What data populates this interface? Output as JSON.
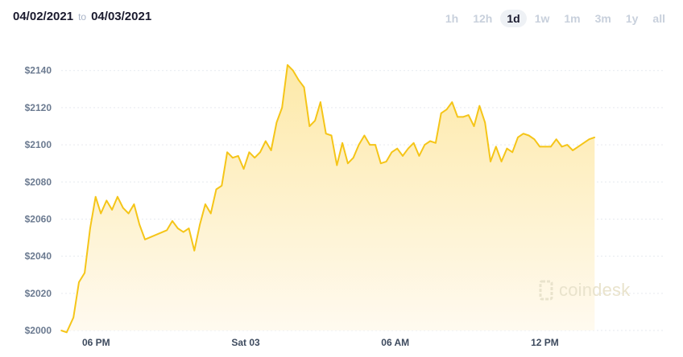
{
  "header": {
    "date_from": "04/02/2021",
    "to_label": "to",
    "date_to": "04/03/2021"
  },
  "range_tabs": [
    {
      "label": "1h",
      "active": false
    },
    {
      "label": "12h",
      "active": false
    },
    {
      "label": "1d",
      "active": true
    },
    {
      "label": "1w",
      "active": false
    },
    {
      "label": "1m",
      "active": false
    },
    {
      "label": "3m",
      "active": false
    },
    {
      "label": "1y",
      "active": false
    },
    {
      "label": "all",
      "active": false
    }
  ],
  "watermark": {
    "text": "coindesk"
  },
  "colors": {
    "line": "#f5c518",
    "fill_top": "#fde9a8",
    "fill_bottom": "#fffaf0",
    "active_tab_bg": "#eef1f5"
  },
  "chart_data": {
    "type": "area",
    "title": "",
    "xlabel": "",
    "ylabel": "",
    "ylim": [
      2000,
      2152
    ],
    "y_ticks": [
      2000,
      2020,
      2040,
      2060,
      2080,
      2100,
      2120,
      2140
    ],
    "y_tick_labels": [
      "$2000",
      "$2020",
      "$2040",
      "$2060",
      "$2080",
      "$2100",
      "$2120",
      "$2140"
    ],
    "x_unit": "hour",
    "x_range": [
      16.6,
      40.8
    ],
    "x_ticks": [
      18,
      24,
      30,
      36
    ],
    "x_tick_labels": [
      "06 PM",
      "Sat 03",
      "06 AM",
      "12 PM"
    ],
    "grid": "horizontal",
    "series": [
      {
        "values": [
          [
            16.6,
            2000
          ],
          [
            16.82,
            1999
          ],
          [
            17.09,
            2007
          ],
          [
            17.31,
            2026
          ],
          [
            17.54,
            2031
          ],
          [
            17.76,
            2055
          ],
          [
            17.98,
            2072
          ],
          [
            18.19,
            2063
          ],
          [
            18.42,
            2070
          ],
          [
            18.64,
            2065
          ],
          [
            18.86,
            2072
          ],
          [
            19.08,
            2066
          ],
          [
            19.3,
            2063
          ],
          [
            19.52,
            2068
          ],
          [
            19.74,
            2057
          ],
          [
            19.96,
            2049
          ],
          [
            20.84,
            2054
          ],
          [
            21.06,
            2059
          ],
          [
            21.28,
            2055
          ],
          [
            21.5,
            2053
          ],
          [
            21.72,
            2055
          ],
          [
            21.94,
            2043
          ],
          [
            22.16,
            2057
          ],
          [
            22.38,
            2068
          ],
          [
            22.6,
            2063
          ],
          [
            22.82,
            2076
          ],
          [
            23.04,
            2078
          ],
          [
            23.26,
            2096
          ],
          [
            23.48,
            2093
          ],
          [
            23.7,
            2094
          ],
          [
            23.92,
            2087
          ],
          [
            24.14,
            2096
          ],
          [
            24.36,
            2093
          ],
          [
            24.58,
            2096
          ],
          [
            24.8,
            2102
          ],
          [
            25.02,
            2097
          ],
          [
            25.24,
            2112
          ],
          [
            25.46,
            2120
          ],
          [
            25.68,
            2143
          ],
          [
            25.9,
            2140
          ],
          [
            26.12,
            2135
          ],
          [
            26.34,
            2131
          ],
          [
            26.56,
            2110
          ],
          [
            26.78,
            2113
          ],
          [
            27.0,
            2123
          ],
          [
            27.22,
            2106
          ],
          [
            27.44,
            2105
          ],
          [
            27.66,
            2089
          ],
          [
            27.88,
            2101
          ],
          [
            28.1,
            2090
          ],
          [
            28.32,
            2093
          ],
          [
            28.54,
            2100
          ],
          [
            28.76,
            2105
          ],
          [
            28.98,
            2100
          ],
          [
            29.2,
            2100
          ],
          [
            29.42,
            2090
          ],
          [
            29.64,
            2091
          ],
          [
            29.86,
            2096
          ],
          [
            30.08,
            2098
          ],
          [
            30.3,
            2094
          ],
          [
            30.52,
            2098
          ],
          [
            30.74,
            2101
          ],
          [
            30.96,
            2094
          ],
          [
            31.18,
            2100
          ],
          [
            31.4,
            2102
          ],
          [
            31.62,
            2101
          ],
          [
            31.84,
            2117
          ],
          [
            32.06,
            2119
          ],
          [
            32.28,
            2123
          ],
          [
            32.5,
            2115
          ],
          [
            32.72,
            2115
          ],
          [
            32.94,
            2116
          ],
          [
            33.16,
            2110
          ],
          [
            33.38,
            2121
          ],
          [
            33.6,
            2112
          ],
          [
            33.82,
            2091
          ],
          [
            34.04,
            2099
          ],
          [
            34.26,
            2091
          ],
          [
            34.48,
            2098
          ],
          [
            34.7,
            2096
          ],
          [
            34.92,
            2104
          ],
          [
            35.14,
            2106
          ],
          [
            35.36,
            2105
          ],
          [
            35.58,
            2103
          ],
          [
            35.8,
            2099
          ],
          [
            36.02,
            2099
          ],
          [
            36.24,
            2099
          ],
          [
            36.46,
            2103
          ],
          [
            36.68,
            2099
          ],
          [
            36.9,
            2100
          ],
          [
            37.12,
            2097
          ],
          [
            37.34,
            2099
          ],
          [
            37.56,
            2101
          ],
          [
            37.78,
            2103
          ],
          [
            38.0,
            2104
          ]
        ]
      }
    ]
  }
}
